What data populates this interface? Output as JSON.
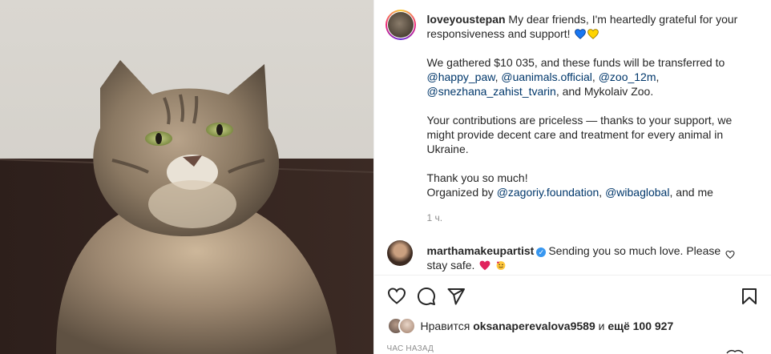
{
  "post": {
    "username": "loveyoustepan",
    "caption_intro": " My dear friends, I'm heartedly grateful for your responsiveness and support!",
    "caption_p2_text": "We gathered $10 035, and these funds will be transferred to",
    "mentions_p2": [
      "@happy_paw",
      "@uanimals.official",
      "@zoo_12m",
      "@snezhana_zahist_tvarin"
    ],
    "caption_p2_tail": ", and Mykolaiv Zoo.",
    "caption_p3": "Your contributions are priceless — thanks to your support, we might provide decent care and treatment for every animal in Ukraine.",
    "caption_p4_line1": "Thank you so much!",
    "caption_p4_line2": "Organized by",
    "mentions_p4": [
      "@zagoriy.foundation",
      "@wibaglobal"
    ],
    "caption_p4_tail": ", and me",
    "time_ago": "1 ч."
  },
  "comment": {
    "username": "marthamakeupartist",
    "text": "Sending you so much love. Please stay safe."
  },
  "likes": {
    "prefix": "Нравится",
    "user": "oksanaperevalova9589",
    "middle": "и",
    "others": "ещё 100 927"
  },
  "timestamp": "ЧАС НАЗАД",
  "icons": {
    "like": "heart-outline-icon",
    "comment": "comment-bubble-icon",
    "share": "paper-plane-icon",
    "save": "bookmark-icon"
  },
  "colors": {
    "text": "#262626",
    "mention": "#00376b",
    "secondary": "#8e8e8e",
    "heart_blue": "#1877f2",
    "heart_yellow": "#ffd400",
    "verified": "#3897f0",
    "emoji_heart_red": "#e0245e"
  }
}
